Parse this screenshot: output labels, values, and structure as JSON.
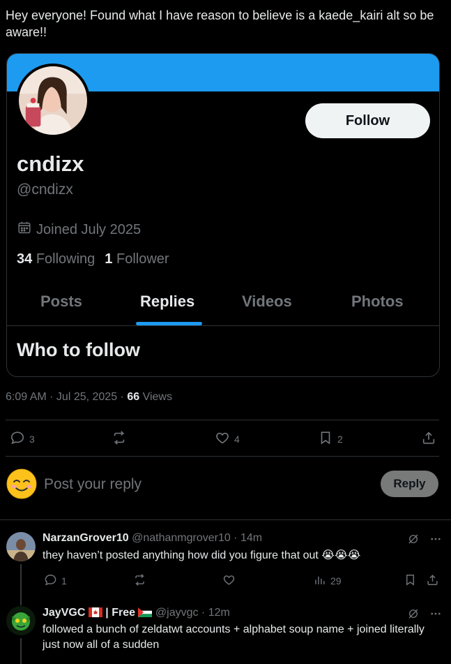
{
  "post": {
    "text": "Hey everyone! Found what I have reason to believe is a kaede_kairi alt so be aware!!"
  },
  "profile_card": {
    "banner_color": "#1d9bf0",
    "follow_label": "Follow",
    "display_name": "cndizx",
    "handle": "@cndizx",
    "joined": "Joined July 2025",
    "following_count": "34",
    "following_label": "Following",
    "followers_count": "1",
    "followers_label": "Follower",
    "tabs": [
      {
        "label": "Posts",
        "active": false
      },
      {
        "label": "Replies",
        "active": true
      },
      {
        "label": "Videos",
        "active": false
      },
      {
        "label": "Photos",
        "active": false
      }
    ],
    "who_to_follow": "Who to follow"
  },
  "meta": {
    "time": "6:09 AM · Jul 25, 2025 · ",
    "views_count": "66",
    "views_label": " Views"
  },
  "actions": {
    "replies": "3",
    "likes": "4",
    "bookmarks": "2"
  },
  "reply_box": {
    "placeholder": "Post your reply",
    "button_label": "Reply"
  },
  "comments": [
    {
      "name": "NarzanGrover10",
      "handle": "@nathanmgrover10",
      "time": " · 14m",
      "text": "they haven’t posted anything how did you figure that out",
      "emoji": "😭😭😭",
      "replies": "1",
      "views": "29"
    },
    {
      "name": "JayVGC",
      "name_suffix": " | Free ",
      "handle": "@jayvgc",
      "time": " · 12m",
      "text": "followed a bunch of zeldatwt accounts + alphabet soup name + joined literally just now all of a sudden"
    }
  ]
}
